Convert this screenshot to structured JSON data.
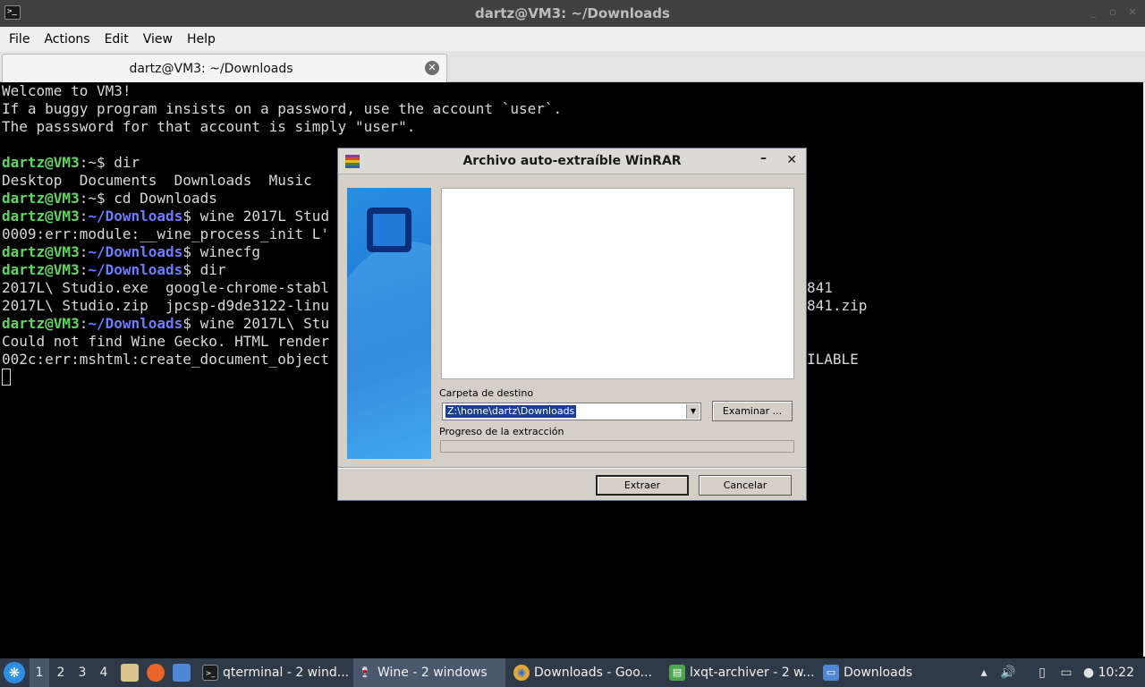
{
  "window": {
    "title": "dartz@VM3: ~/Downloads",
    "controls": [
      "_",
      "▫",
      "✕"
    ]
  },
  "menubar": {
    "items": [
      "File",
      "Actions",
      "Edit",
      "View",
      "Help"
    ]
  },
  "tab": {
    "label": "dartz@VM3: ~/Downloads"
  },
  "terminal": {
    "prompt_user": "dartz@VM3",
    "prompt_home": ":~$ ",
    "prompt_dl_path": "~/Downloads",
    "prompt_dl_colon": ":",
    "prompt_dl_dollar": "$ ",
    "welcome": [
      "Welcome to VM3!",
      "If a buggy program insists on a password, use the account `user`.",
      "The passsword for that account is simply \"user\"."
    ],
    "cmd_dir": "dir",
    "dir_home_output": "Desktop  Documents  Downloads  Music",
    "cmd_cd": "cd Downloads",
    "cmd_wine1": "wine 2017L Stud",
    "err_module": "0009:err:module:__wine_process_init L'",
    "cmd_winecfg": "winecfg",
    "cmd_dir2": "dir",
    "dl_row1": "2017L\\ Studio.exe  google-chrome-stabl",
    "dl_row1_end": "841",
    "dl_row2": "2017L\\ Studio.zip  jpcsp-d9de3122-linu",
    "dl_row2_end": "841.zip",
    "cmd_wine2": "wine 2017L\\ Stu",
    "gecko": "Could not find Wine Gecko. HTML render",
    "mshtml": "002c:err:mshtml:create_document_object",
    "mshtml_end": "ILABLE"
  },
  "winrar": {
    "title": "Archivo auto-extraíble WinRAR",
    "minimize": "–",
    "close": "✕",
    "dest_label": "Carpeta de destino",
    "dest_value": "Z:\\home\\dartz\\Downloads",
    "browse": "Examinar ...",
    "progress_label": "Progreso de la extracción",
    "progress": 0,
    "extract": "Extraer",
    "cancel": "Cancelar"
  },
  "taskbar": {
    "desktops": [
      "1",
      "2",
      "3",
      "4"
    ],
    "tasks": [
      {
        "label": "qterminal - 2 wind...",
        "icon": ">_"
      },
      {
        "label": "Wine - 2 windows",
        "icon": "🍷"
      },
      {
        "label": "Downloads - Goo...",
        "icon": "◉"
      },
      {
        "label": "lxqt-archiver - 2 w...",
        "icon": "▤"
      },
      {
        "label": "Downloads",
        "icon": "▭"
      }
    ],
    "clock": "10:22"
  },
  "colors": {
    "prompt_user": "#5fd75f",
    "prompt_path": "#6b7cff",
    "taskbar_bg": "#2f3a48",
    "dialog_bg": "#d4d0c8"
  }
}
